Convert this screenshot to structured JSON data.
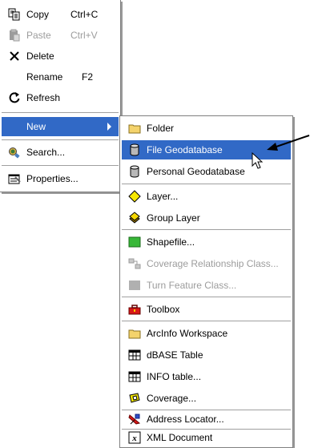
{
  "main_menu": {
    "copy": {
      "label": "Copy",
      "shortcut": "Ctrl+C",
      "icon": "copy-icon"
    },
    "paste": {
      "label": "Paste",
      "shortcut": "Ctrl+V",
      "icon": "paste-icon"
    },
    "delete": {
      "label": "Delete",
      "icon": "delete-x-icon"
    },
    "rename": {
      "label": "Rename",
      "shortcut": "F2"
    },
    "refresh": {
      "label": "Refresh",
      "icon": "refresh-icon"
    },
    "new": {
      "label": "New"
    },
    "search": {
      "label": "Search...",
      "icon": "search-icon"
    },
    "properties": {
      "label": "Properties...",
      "icon": "properties-icon"
    }
  },
  "sub_menu": {
    "items": [
      {
        "label": "Folder",
        "icon": "folder-icon"
      },
      {
        "label": "File Geodatabase",
        "icon": "database-icon"
      },
      {
        "label": "Personal Geodatabase",
        "icon": "database-icon"
      },
      {
        "label": "Layer...",
        "icon": "layer-diamond-icon"
      },
      {
        "label": "Group Layer",
        "icon": "group-layer-icon"
      },
      {
        "label": "Shapefile...",
        "icon": "shapefile-icon"
      },
      {
        "label": "Coverage Relationship Class...",
        "icon": "relationship-class-icon"
      },
      {
        "label": "Turn Feature Class...",
        "icon": "turn-feature-icon"
      },
      {
        "label": "Toolbox",
        "icon": "toolbox-icon"
      },
      {
        "label": "ArcInfo Workspace",
        "icon": "folder-icon"
      },
      {
        "label": "dBASE Table",
        "icon": "table-icon"
      },
      {
        "label": "INFO table...",
        "icon": "table-icon"
      },
      {
        "label": "Coverage...",
        "icon": "coverage-icon"
      },
      {
        "label": "Address Locator...",
        "icon": "address-locator-icon"
      },
      {
        "label": "XML Document",
        "icon": "xml-document-icon"
      }
    ]
  },
  "colors": {
    "highlight": "#3169c6",
    "disabled": "#9c9c9c"
  }
}
